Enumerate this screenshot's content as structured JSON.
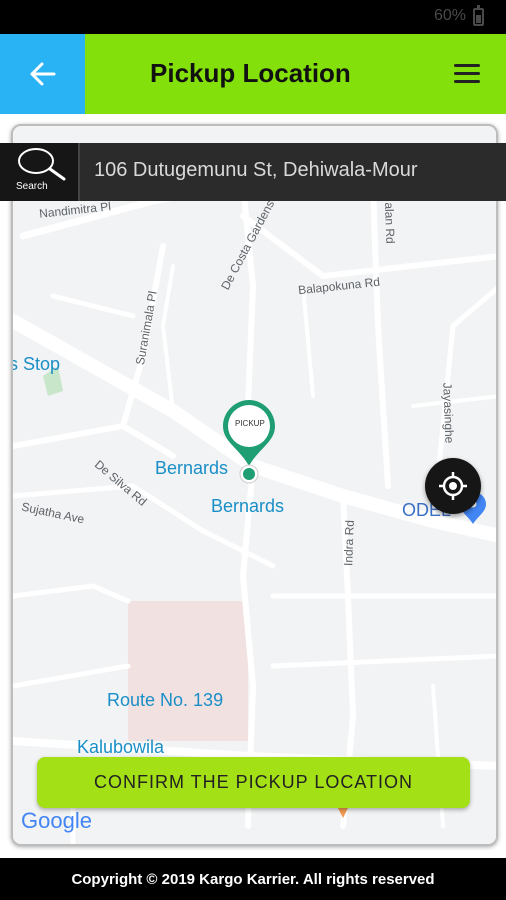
{
  "status_bar": {
    "battery": "60%"
  },
  "header": {
    "title": "Pickup Location"
  },
  "search": {
    "label": "Search",
    "value": "106 Dutugemunu St, Dehiwala-Mour"
  },
  "map": {
    "streets": [
      "Nandimitra Pl",
      "De Costa Gardens",
      "Balapokuna Rd",
      "Suranimala Pl",
      "De Silva Rd",
      "Sujatha Ave",
      "Indra Rd",
      "Jayasinghe",
      "alan Rd"
    ],
    "pois": [
      "s Stop",
      "Bernards",
      "Bernards",
      "ODEL",
      "Route No. 139",
      "Kalubowila"
    ],
    "marker_label": "PICKUP",
    "logo": "Google"
  },
  "confirm_button": {
    "label": "CONFIRM THE PICKUP LOCATION"
  },
  "footer": {
    "copyright": "Copyright © 2019 Kargo Karrier. All rights reserved"
  },
  "colors": {
    "header_green": "#84e00a",
    "back_blue": "#29b3f5",
    "confirm_green": "#a4e016",
    "marker_teal": "#1e9e72"
  },
  "icons": {
    "back": "arrow-left-icon",
    "menu": "hamburger-menu-icon",
    "search": "magnifier-icon",
    "locate": "my-location-icon",
    "marker": "map-pin-icon"
  }
}
